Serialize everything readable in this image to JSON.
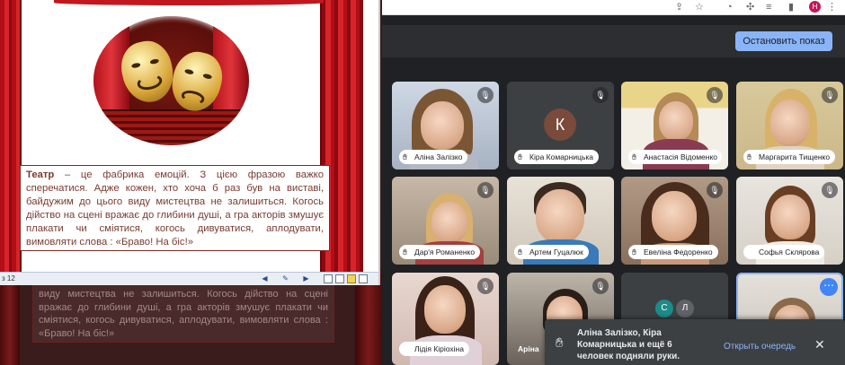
{
  "presentation": {
    "text_bold": "Театр",
    "text_body": " – це фабрика емоцій. З цією фразою важко сперечатися. Адже кожен, хто хоча б раз був на виставі, байдужим до цього виду мистецтва не залишиться. Когось дійство на сцені вражає до глибини душі, а гра акторів змушує плакати чи сміятися, когось дивуватися, аплодувати, вимовляти слова : «Браво! На біс!»",
    "background_text": "виду мистецтва не залишиться. Когось дійство на сцені вражає до глибини душі, а гра акторів змушує плакати чи сміятися, когось дивуватися, аплодувати, вимовляти слова : «Браво! На біс!»",
    "status_slide": "з 12"
  },
  "browser": {
    "profile_initial": "Н"
  },
  "meet": {
    "stop_button": "Остановить показ",
    "participants": [
      {
        "name": "Аліна Залізко",
        "hand": true
      },
      {
        "name": "Кіра Комарницька",
        "hand": true,
        "initial": "К"
      },
      {
        "name": "Анастасія Відоменко",
        "hand": true
      },
      {
        "name": "Маргарита Тищенко",
        "hand": true
      },
      {
        "name": "Дар'я Романенко",
        "hand": true
      },
      {
        "name": "Артем Гуцалюк",
        "hand": true
      },
      {
        "name": "Евеліна Федоренко",
        "hand": true
      },
      {
        "name": "Софья Склярова",
        "hand": false
      },
      {
        "name": "Лідія Кіріохіна",
        "hand": false
      },
      {
        "name": "Аріна",
        "hand": false
      },
      {
        "name": "",
        "hand": false,
        "initials": [
          "С",
          "Л"
        ]
      },
      {
        "name": "",
        "hand": false
      }
    ],
    "toast": {
      "message": "Аліна Залізко, Кіра Комарницька и ещё 6 человек подняли руки.",
      "action": "Открыть очередь"
    }
  },
  "colors": {
    "meet_bg": "#202124",
    "accent_blue": "#8ab4f8",
    "curtain_red": "#c2171f",
    "slide_text": "#7a3a30"
  }
}
